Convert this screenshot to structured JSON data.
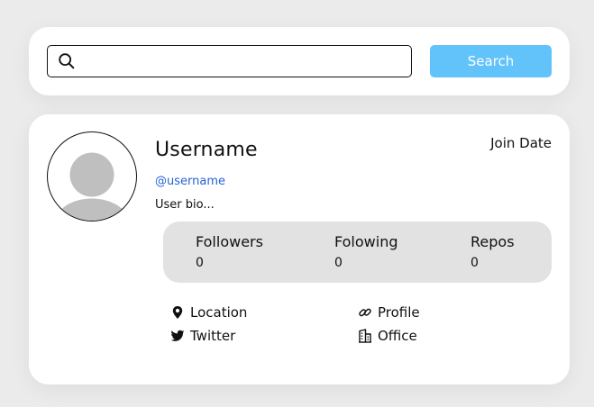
{
  "search": {
    "placeholder": "",
    "value": "",
    "button_label": "Search",
    "accent_color": "#62c3fb"
  },
  "profile": {
    "username": "Username",
    "handle": "@username",
    "bio": "User bio...",
    "join_date": "Join Date",
    "avatar_icon": "default-user-avatar"
  },
  "stats": [
    {
      "label": "Followers",
      "value": "0"
    },
    {
      "label": "Folowing",
      "value": "0"
    },
    {
      "label": "Repos",
      "value": "0"
    }
  ],
  "links": {
    "location": {
      "label": "Location",
      "icon": "map-pin-icon"
    },
    "profile": {
      "label": "Profile",
      "icon": "link-icon"
    },
    "twitter": {
      "label": "Twitter",
      "icon": "twitter-bird-icon"
    },
    "office": {
      "label": "Office",
      "icon": "office-building-icon"
    }
  },
  "colors": {
    "background": "#ebebeb",
    "card": "#ffffff",
    "stats_bg": "#e2e2e2",
    "handle": "#2563d8",
    "avatar_fill": "#bfbfbf"
  }
}
